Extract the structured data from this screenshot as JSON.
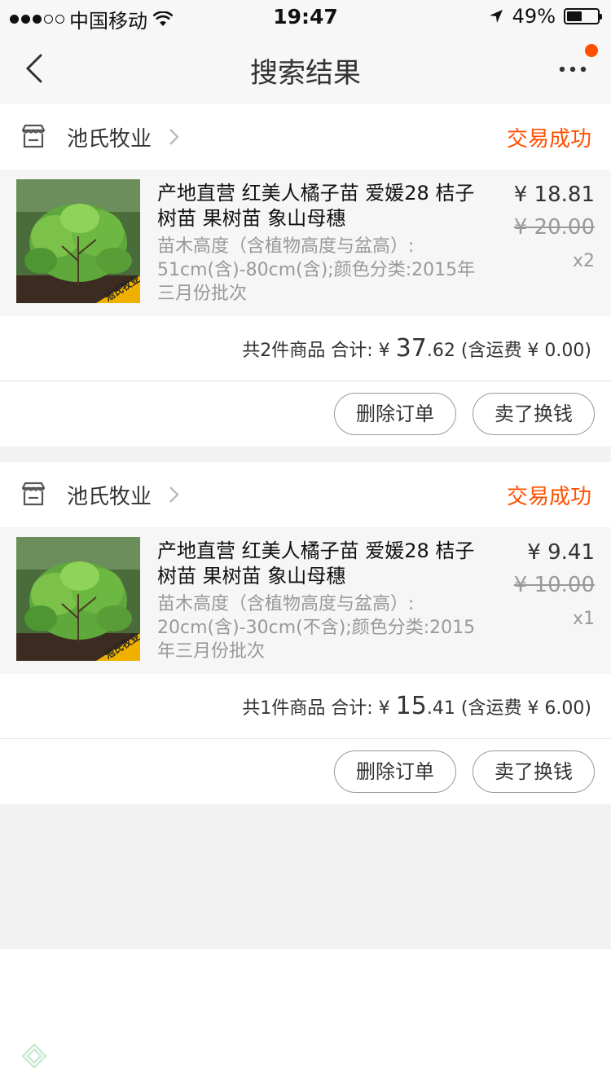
{
  "status_bar": {
    "carrier": "中国移动",
    "time": "19:47",
    "battery": "49%",
    "battery_level": 0.49
  },
  "nav": {
    "title": "搜索结果"
  },
  "orders": [
    {
      "shop": "池氏牧业",
      "status": "交易成功",
      "item": {
        "title": "产地直营 红美人橘子苗 爱媛28 桔子树苗 果树苗 象山母穗",
        "spec": "苗木高度（含植物高度与盆高）: 51cm(含)-80cm(含);颜色分类:2015年三月份批次",
        "price": "¥ 18.81",
        "original_price": "¥ 20.00",
        "qty": "x2",
        "watermark": "池氏牧业"
      },
      "summary": {
        "count_label": "共2件商品 合计: ¥",
        "total_int": "37",
        "total_dec": ".62",
        "shipping": "(含运费 ¥ 0.00)"
      },
      "actions": {
        "delete": "删除订单",
        "sell": "卖了换钱"
      }
    },
    {
      "shop": "池氏牧业",
      "status": "交易成功",
      "item": {
        "title": "产地直营 红美人橘子苗 爱媛28 桔子树苗 果树苗 象山母穗",
        "spec": "苗木高度（含植物高度与盆高）: 20cm(含)-30cm(不含);颜色分类:2015年三月份批次",
        "price": "¥ 9.41",
        "original_price": "¥ 10.00",
        "qty": "x1",
        "watermark": "池氏牧业"
      },
      "summary": {
        "count_label": "共1件商品 合计: ¥",
        "total_int": "15",
        "total_dec": ".41",
        "shipping": "(含运费 ¥ 6.00)"
      },
      "actions": {
        "delete": "删除订单",
        "sell": "卖了换钱"
      }
    }
  ],
  "colors": {
    "accent": "#ff5000",
    "page_bg": "#f2f2f2",
    "item_bg": "#f6f6f6"
  }
}
